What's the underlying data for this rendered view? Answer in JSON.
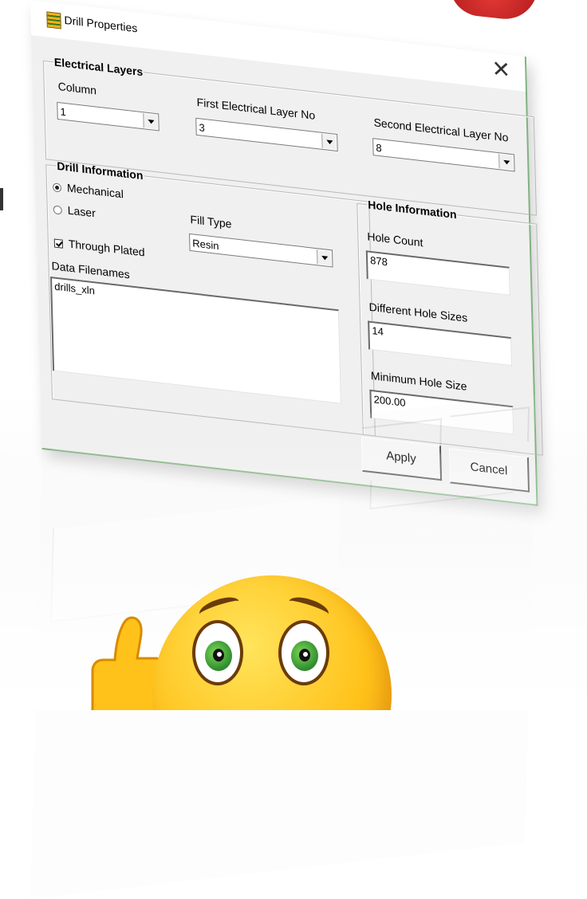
{
  "window": {
    "title": "Drill Properties",
    "close_glyph": "✕",
    "icon": "app-icon"
  },
  "electrical_layers": {
    "legend": "Electrical Layers",
    "column_label": "Column",
    "column_value": "1",
    "first_layer_label": "First Electrical Layer No",
    "first_layer_value": "3",
    "second_layer_label": "Second Electrical Layer No",
    "second_layer_value": "8"
  },
  "drill_information": {
    "legend": "Drill Information",
    "mechanical_label": "Mechanical",
    "mechanical_selected": true,
    "laser_label": "Laser",
    "laser_selected": false,
    "through_plated_label": "Through Plated",
    "through_plated_checked": true,
    "fill_type_label": "Fill Type",
    "fill_type_value": "Resin",
    "data_filenames_label": "Data Filenames",
    "data_filenames_value": "drills_xln"
  },
  "hole_information": {
    "legend": "Hole Information",
    "hole_count_label": "Hole Count",
    "hole_count_value": "878",
    "different_sizes_label": "Different Hole Sizes",
    "different_sizes_value": "14",
    "min_size_label": "Minimum Hole Size",
    "min_size_value": "200.00"
  },
  "buttons": {
    "apply": "Apply",
    "cancel": "Cancel"
  },
  "colors": {
    "dialog_bg": "#f0f0f0",
    "accent_border": "#7fb27f",
    "emoji_yellow": "#ffc21a",
    "badge_red": "#c62828"
  }
}
